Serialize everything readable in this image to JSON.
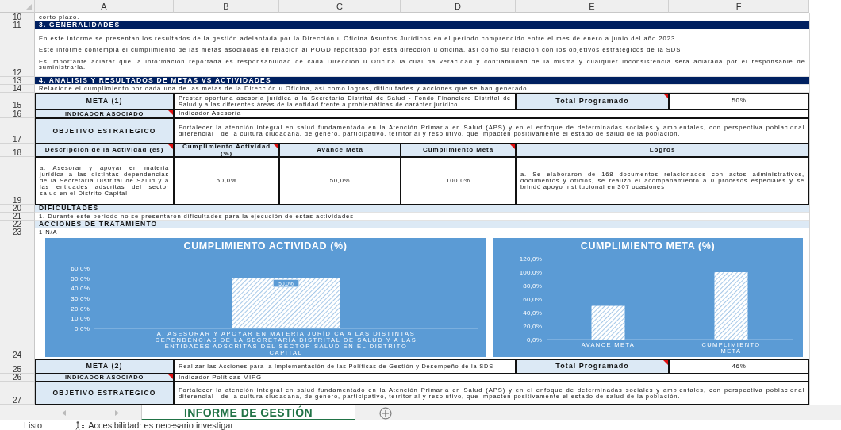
{
  "column_headers": [
    "A",
    "B",
    "C",
    "D",
    "E",
    "F"
  ],
  "row_numbers": [
    "10",
    "11",
    "12",
    "13",
    "14",
    "15",
    "16",
    "17",
    "18",
    "19",
    "20",
    "21",
    "22",
    "23",
    "24",
    "25",
    "26",
    "27"
  ],
  "intro_tail": "corto plazo.",
  "generalidades": {
    "title": "3. GENERALIDADES",
    "paragraphs": [
      "En este informe se presentan los resultados de la gestión adelantada por la Dirección u Oficina Asuntos Jurídicos  en el periodo comprendido entre el mes de enero a junio del año 2023.",
      "Este informe contempla el cumplimiento de las metas asociadas en relación al POGD reportado por esta dirección u oficina, así como su relación con los objetivos estratégicos de la SDS.",
      "Es importante aclarar que la información reportada es responsabilidad de cada Dirección u Oficina la cual da veracidad y confiabilidad de la misma y cualquier inconsistencia será aclarada por el responsable de suministrarla."
    ]
  },
  "analisis": {
    "title": "4. ANALISIS Y RESULTADOS DE METAS VS ACTIVIDADES",
    "instruction": "Relacione el cumplimiento por cada una de las metas de la Dirección u Oficina, así como logros, dificultades y acciones que se han generado:"
  },
  "metas": [
    {
      "label": {
        "text": "META (1)",
        "comment": false
      },
      "description": "Prestar oportuna asesoría jurídica a la Secretaría Distrital de Salud - Fondo Financiero Distrital de Salud y a las diferentes áreas de la entidad frente a problemáticas de carácter jurídico",
      "total_label": {
        "text": "Total Programado",
        "comment": true
      },
      "total_value": "50%",
      "indicator_label": {
        "text": "INDICADOR ASOCIADO",
        "comment": true
      },
      "indicator": "Indicador Asesoría",
      "objective_label": "OBJETIVO ESTRATEGICO",
      "objective": "Fortalecer la atención integral en salud fundamentado en la Atención Primaria en Salud (APS) y en el enfoque de determinadas sociales y ambientales, con perspectiva poblacional diferencial , de la cultura ciudadana, de genero, participativo, territorial y resolutivo, que impacten positivamente el estado de salud de la población."
    },
    {
      "label": {
        "text": "META (2)",
        "comment": false
      },
      "description": "Realizar las Acciones para la Implementación de las Políticas de Gestión y Desempeño de la SDS",
      "total_label": {
        "text": "Total Programado",
        "comment": true
      },
      "total_value": "46%",
      "indicator_label": {
        "text": "INDICADOR ASOCIADO",
        "comment": true
      },
      "indicator": "Indicador Políticas MIPG",
      "objective_label": "OBJETIVO ESTRATEGICO",
      "objective": "Fortalecer la atención integral en salud fundamentado en la Atención Primaria en Salud (APS) y en el enfoque de determinadas sociales y ambientales, con perspectiva poblacional diferencial , de la cultura ciudadana, de genero, participativo, territorial y resolutivo, que impacten positivamente el estado de salud de la población."
    }
  ],
  "activity_table": {
    "columns": [
      {
        "text": "Descripción de la Actividad (es)",
        "comment": true
      },
      {
        "text": "Cumplimiento Actividad (%)",
        "comment": true
      },
      {
        "text": "Avance Meta",
        "comment": false
      },
      {
        "text": "Cumplimiento Meta",
        "comment": true
      },
      {
        "text": "Logros",
        "comment": false
      }
    ],
    "rows": [
      [
        "a. Asesorar y apoyar en materia jurídica a las distintas dependencias de la Secretaría Distrital de Salud y a las entidades adscritas del sector salud en el Distrito Capital",
        "50,0%",
        "50,0%",
        "100,0%",
        "a. Se elaboraron de 168 documentos relacionados con actos administrativos, documentos y oficios, se realizó el acompañamiento a 0 procesos especiales y se brindó apoyo institucional en 307 ocasiones"
      ]
    ]
  },
  "dificultades": {
    "title": "DIFICULTADES",
    "text": "1. Durante este periodo no se presentaron dificultades para la ejecución de estas actividades"
  },
  "acciones": {
    "title": "ACCIONES DE TRATAMIENTO",
    "text": "1 N/A"
  },
  "charts": [
    {
      "chart_data": {
        "type": "bar",
        "title": "CUMPLIMIENTO ACTIVIDAD (%)",
        "categories": [
          "A. ASESORAR Y APOYAR EN MATERIA JURÍDICA A LAS DISTINTAS DEPENDENCIAS DE LA SECRETARÍA DISTRITAL DE SALUD Y A LAS ENTIDADES ADSCRITAS DEL SECTOR SALUD EN EL DISTRITO CAPITAL"
        ],
        "values": [
          50
        ],
        "ylim": [
          0,
          60
        ],
        "yticks": [
          {
            "value": 0,
            "label": "0,0%"
          },
          {
            "value": 10,
            "label": "10,0%"
          },
          {
            "value": 20,
            "label": "20,0%"
          },
          {
            "value": 30,
            "label": "30,0%"
          },
          {
            "value": 40,
            "label": "40,0%"
          },
          {
            "value": 50,
            "label": "50,0%"
          },
          {
            "value": 60,
            "label": "60,0%"
          }
        ],
        "value_labels": [
          "50,0%"
        ]
      }
    },
    {
      "chart_data": {
        "type": "bar",
        "title": "CUMPLIMIENTO META (%)",
        "categories": [
          "AVANCE META",
          "CUMPLIMIENTO META"
        ],
        "values": [
          50,
          100
        ],
        "ylim": [
          0,
          120
        ],
        "yticks": [
          {
            "value": 0,
            "label": "0,0%"
          },
          {
            "value": 20,
            "label": "20,0%"
          },
          {
            "value": 40,
            "label": "40,0%"
          },
          {
            "value": 60,
            "label": "60,0%"
          },
          {
            "value": 80,
            "label": "80,0%"
          },
          {
            "value": 100,
            "label": "100,0%"
          },
          {
            "value": 120,
            "label": "120,0%"
          }
        ]
      }
    }
  ],
  "sheet_tabs": [
    {
      "label": "INFORME DE GESTIÓN",
      "selected": true
    }
  ],
  "status_bar": {
    "status": "Listo",
    "accessibility": "Accesibilidad: es necesario investigar"
  }
}
